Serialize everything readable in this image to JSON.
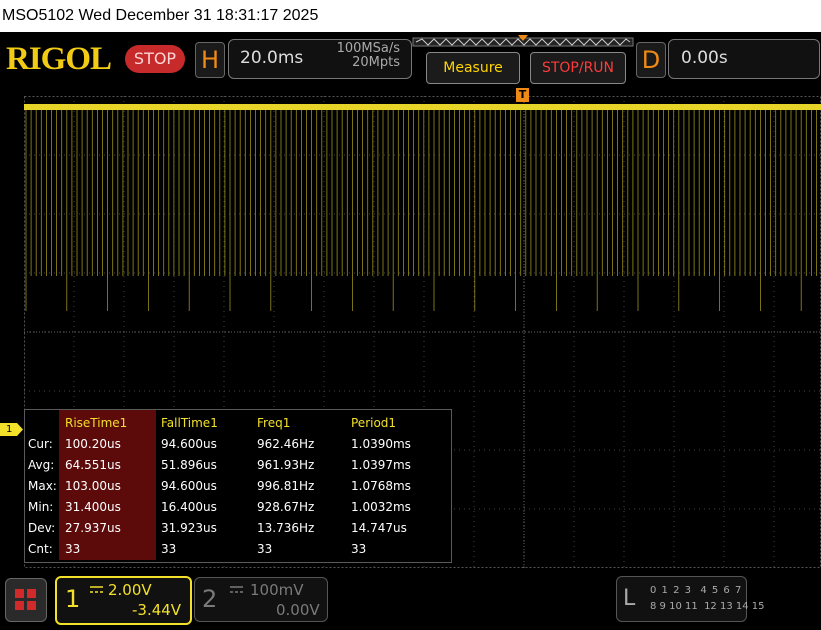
{
  "titlebar": {
    "text": "MSO5102  Wed December 31 18:31:17 2025"
  },
  "header": {
    "logo": "RIGOL",
    "status": "STOP",
    "horizontal": {
      "letter": "H",
      "timebase": "20.0ms",
      "sample_rate": "100MSa/s",
      "memory_depth": "20Mpts"
    },
    "delay": {
      "letter": "D",
      "value": "0.00s"
    },
    "buttons": {
      "measure": "Measure",
      "stop_run": "STOP/RUN"
    }
  },
  "trigger_marker": "T",
  "channel_marker": "1",
  "measurements": {
    "row_labels": [
      "Cur:",
      "Avg:",
      "Max:",
      "Min:",
      "Dev:",
      "Cnt:"
    ],
    "columns": [
      {
        "header": "RiseTime1",
        "values": [
          "100.20us",
          "64.551us",
          "103.00us",
          "31.400us",
          "27.937us",
          "33"
        ]
      },
      {
        "header": "FallTime1",
        "values": [
          "94.600us",
          "51.896us",
          "94.600us",
          "16.400us",
          "31.923us",
          "33"
        ]
      },
      {
        "header": "Freq1",
        "values": [
          "962.46Hz",
          "961.93Hz",
          "996.81Hz",
          "928.67Hz",
          "13.736Hz",
          "33"
        ]
      },
      {
        "header": "Period1",
        "values": [
          "1.0390ms",
          "1.0397ms",
          "1.0768ms",
          "1.0032ms",
          "14.747us",
          "33"
        ]
      }
    ]
  },
  "channels": [
    {
      "number": "1",
      "scale": "2.00V",
      "offset": "-3.44V",
      "color": "#f2e02a"
    },
    {
      "number": "2",
      "scale": "100mV",
      "offset": "0.00V",
      "color": "#7a7a7a"
    }
  ],
  "logic": {
    "letter": "L",
    "row1": "0 1 2 3  4 5 6 7",
    "row2": "8 9 10 11  12 13 14 15"
  },
  "colors": {
    "trace": "#f2e02a",
    "accent": "#f08a16",
    "stop": "#c62a2a"
  }
}
